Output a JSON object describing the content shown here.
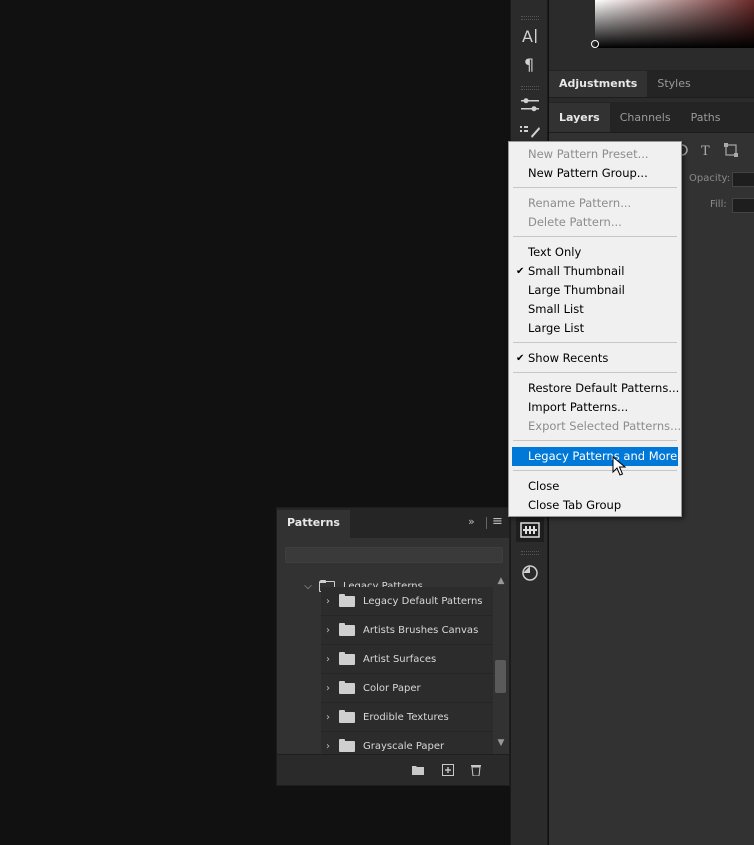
{
  "right_panel": {
    "tabs_top": [
      "Adjustments",
      "Styles"
    ],
    "tabs_layers": [
      "Layers",
      "Channels",
      "Paths"
    ],
    "opacity_label": "Opacity:",
    "fill_label": "Fill:"
  },
  "patterns_panel": {
    "title": "Patterns",
    "collapse_icon": "double-chevron-right-icon",
    "menu_icon": "hamburger-menu-icon",
    "parent_folder": "Legacy Patterns",
    "items": [
      "Legacy Default Patterns",
      "Artists Brushes Canvas",
      "Artist Surfaces",
      "Color Paper",
      "Erodible Textures",
      "Grayscale Paper"
    ],
    "footer_icons": [
      "new-group-folder-icon",
      "new-pattern-icon",
      "trash-icon"
    ]
  },
  "context_menu": {
    "new_pattern_preset": "New Pattern Preset...",
    "new_pattern_group": "New Pattern Group...",
    "rename_pattern": "Rename Pattern...",
    "delete_pattern": "Delete Pattern...",
    "text_only": "Text Only",
    "small_thumbnail": "Small Thumbnail",
    "large_thumbnail": "Large Thumbnail",
    "small_list": "Small List",
    "large_list": "Large List",
    "show_recents": "Show Recents",
    "restore_default": "Restore Default Patterns...",
    "import_patterns": "Import Patterns...",
    "export_selected": "Export Selected Patterns...",
    "legacy_more": "Legacy Patterns and More",
    "close": "Close",
    "close_tab_group": "Close Tab Group",
    "check_mark": "✔"
  },
  "colors": {
    "highlight": "#0078d7",
    "menu_bg": "#f0f0f0",
    "panel_bg": "#323232",
    "app_bg": "#111111"
  }
}
